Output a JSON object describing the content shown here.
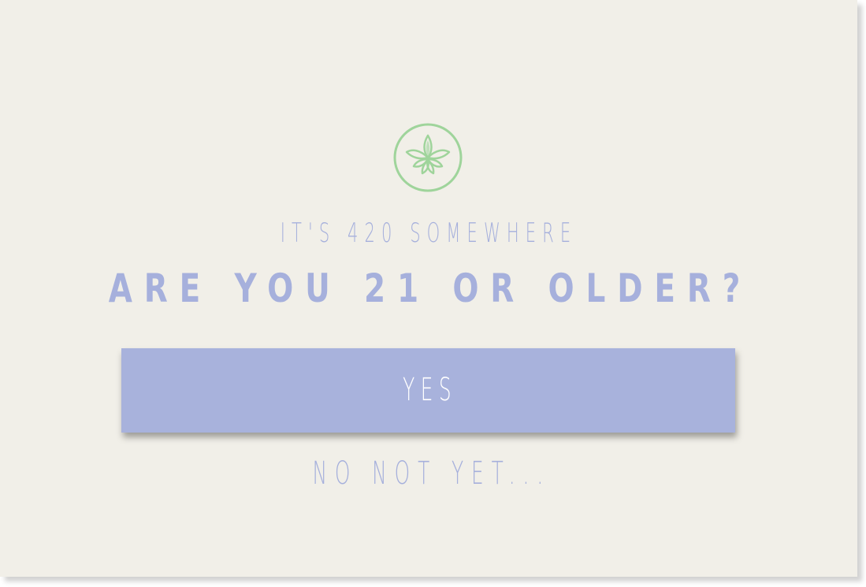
{
  "age_gate": {
    "logo_icon": "cannabis-leaf-icon",
    "tagline": "IT'S 420 SOMEWHERE",
    "question": "ARE YOU 21 OR OLDER?",
    "yes_label": "YES",
    "no_label": "NO NOT YET..."
  },
  "colors": {
    "background": "#f1efe8",
    "accent": "#a8b2dc",
    "logo_green": "#9fd49b"
  }
}
